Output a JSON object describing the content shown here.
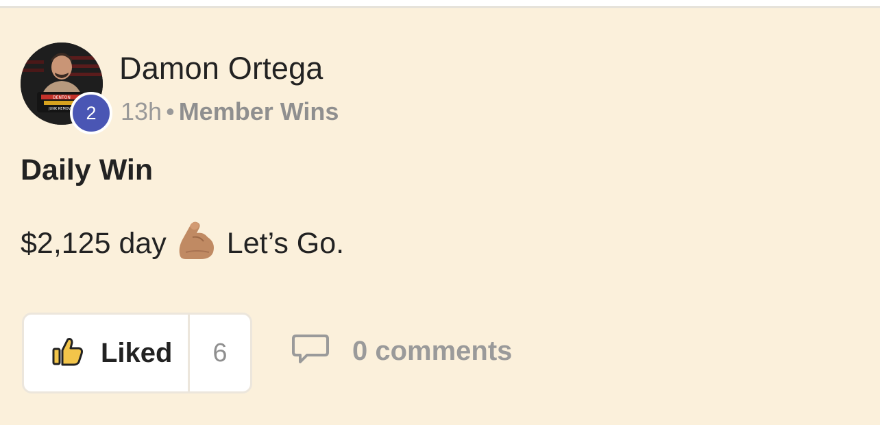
{
  "post": {
    "author": {
      "name": "Damon Ortega",
      "level": "2",
      "avatar_icon": "profile-photo-with-denton-hauling-logo"
    },
    "meta": {
      "time": "13h",
      "separator": "•",
      "category": "Member Wins"
    },
    "title": "Daily Win",
    "body": {
      "before_emoji": "$2,125 day",
      "emoji_icon": "flexed-biceps-icon",
      "after_emoji": "Let’s Go."
    },
    "actions": {
      "like_label": "Liked",
      "like_count": "6",
      "comments_label": "0 comments"
    },
    "colors": {
      "card_background": "#fbf0db",
      "level_badge": "#4a56b4",
      "thumb_icon": "#f3c54a"
    }
  }
}
